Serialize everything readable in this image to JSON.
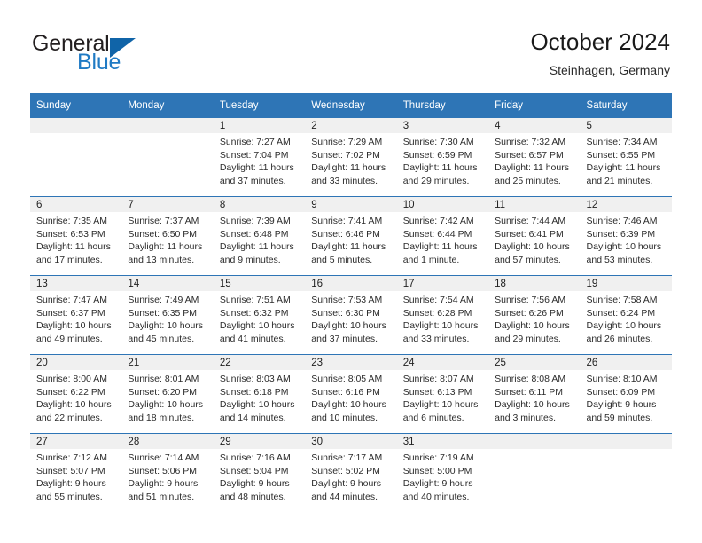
{
  "brand": {
    "name_part1": "General",
    "name_part2": "Blue",
    "triangle_color": "#1064a8",
    "blue_color": "#1f7ac4"
  },
  "header": {
    "title": "October 2024",
    "subtitle": "Steinhagen, Germany"
  },
  "theme": {
    "header_blue": "#2e75b6",
    "date_band_gray": "#f0f0f0",
    "row_divider": "#2e75b6"
  },
  "labels": {
    "sunrise_prefix": "Sunrise:",
    "sunset_prefix": "Sunset:",
    "daylight_prefix": "Daylight:"
  },
  "weekdays": [
    "Sunday",
    "Monday",
    "Tuesday",
    "Wednesday",
    "Thursday",
    "Friday",
    "Saturday"
  ],
  "weeks": [
    [
      {
        "day": "",
        "sunrise": "",
        "sunset": "",
        "daylight_1": "",
        "daylight_2": ""
      },
      {
        "day": "",
        "sunrise": "",
        "sunset": "",
        "daylight_1": "",
        "daylight_2": ""
      },
      {
        "day": "1",
        "sunrise": "Sunrise: 7:27 AM",
        "sunset": "Sunset: 7:04 PM",
        "daylight_1": "Daylight: 11 hours",
        "daylight_2": "and 37 minutes."
      },
      {
        "day": "2",
        "sunrise": "Sunrise: 7:29 AM",
        "sunset": "Sunset: 7:02 PM",
        "daylight_1": "Daylight: 11 hours",
        "daylight_2": "and 33 minutes."
      },
      {
        "day": "3",
        "sunrise": "Sunrise: 7:30 AM",
        "sunset": "Sunset: 6:59 PM",
        "daylight_1": "Daylight: 11 hours",
        "daylight_2": "and 29 minutes."
      },
      {
        "day": "4",
        "sunrise": "Sunrise: 7:32 AM",
        "sunset": "Sunset: 6:57 PM",
        "daylight_1": "Daylight: 11 hours",
        "daylight_2": "and 25 minutes."
      },
      {
        "day": "5",
        "sunrise": "Sunrise: 7:34 AM",
        "sunset": "Sunset: 6:55 PM",
        "daylight_1": "Daylight: 11 hours",
        "daylight_2": "and 21 minutes."
      }
    ],
    [
      {
        "day": "6",
        "sunrise": "Sunrise: 7:35 AM",
        "sunset": "Sunset: 6:53 PM",
        "daylight_1": "Daylight: 11 hours",
        "daylight_2": "and 17 minutes."
      },
      {
        "day": "7",
        "sunrise": "Sunrise: 7:37 AM",
        "sunset": "Sunset: 6:50 PM",
        "daylight_1": "Daylight: 11 hours",
        "daylight_2": "and 13 minutes."
      },
      {
        "day": "8",
        "sunrise": "Sunrise: 7:39 AM",
        "sunset": "Sunset: 6:48 PM",
        "daylight_1": "Daylight: 11 hours",
        "daylight_2": "and 9 minutes."
      },
      {
        "day": "9",
        "sunrise": "Sunrise: 7:41 AM",
        "sunset": "Sunset: 6:46 PM",
        "daylight_1": "Daylight: 11 hours",
        "daylight_2": "and 5 minutes."
      },
      {
        "day": "10",
        "sunrise": "Sunrise: 7:42 AM",
        "sunset": "Sunset: 6:44 PM",
        "daylight_1": "Daylight: 11 hours",
        "daylight_2": "and 1 minute."
      },
      {
        "day": "11",
        "sunrise": "Sunrise: 7:44 AM",
        "sunset": "Sunset: 6:41 PM",
        "daylight_1": "Daylight: 10 hours",
        "daylight_2": "and 57 minutes."
      },
      {
        "day": "12",
        "sunrise": "Sunrise: 7:46 AM",
        "sunset": "Sunset: 6:39 PM",
        "daylight_1": "Daylight: 10 hours",
        "daylight_2": "and 53 minutes."
      }
    ],
    [
      {
        "day": "13",
        "sunrise": "Sunrise: 7:47 AM",
        "sunset": "Sunset: 6:37 PM",
        "daylight_1": "Daylight: 10 hours",
        "daylight_2": "and 49 minutes."
      },
      {
        "day": "14",
        "sunrise": "Sunrise: 7:49 AM",
        "sunset": "Sunset: 6:35 PM",
        "daylight_1": "Daylight: 10 hours",
        "daylight_2": "and 45 minutes."
      },
      {
        "day": "15",
        "sunrise": "Sunrise: 7:51 AM",
        "sunset": "Sunset: 6:32 PM",
        "daylight_1": "Daylight: 10 hours",
        "daylight_2": "and 41 minutes."
      },
      {
        "day": "16",
        "sunrise": "Sunrise: 7:53 AM",
        "sunset": "Sunset: 6:30 PM",
        "daylight_1": "Daylight: 10 hours",
        "daylight_2": "and 37 minutes."
      },
      {
        "day": "17",
        "sunrise": "Sunrise: 7:54 AM",
        "sunset": "Sunset: 6:28 PM",
        "daylight_1": "Daylight: 10 hours",
        "daylight_2": "and 33 minutes."
      },
      {
        "day": "18",
        "sunrise": "Sunrise: 7:56 AM",
        "sunset": "Sunset: 6:26 PM",
        "daylight_1": "Daylight: 10 hours",
        "daylight_2": "and 29 minutes."
      },
      {
        "day": "19",
        "sunrise": "Sunrise: 7:58 AM",
        "sunset": "Sunset: 6:24 PM",
        "daylight_1": "Daylight: 10 hours",
        "daylight_2": "and 26 minutes."
      }
    ],
    [
      {
        "day": "20",
        "sunrise": "Sunrise: 8:00 AM",
        "sunset": "Sunset: 6:22 PM",
        "daylight_1": "Daylight: 10 hours",
        "daylight_2": "and 22 minutes."
      },
      {
        "day": "21",
        "sunrise": "Sunrise: 8:01 AM",
        "sunset": "Sunset: 6:20 PM",
        "daylight_1": "Daylight: 10 hours",
        "daylight_2": "and 18 minutes."
      },
      {
        "day": "22",
        "sunrise": "Sunrise: 8:03 AM",
        "sunset": "Sunset: 6:18 PM",
        "daylight_1": "Daylight: 10 hours",
        "daylight_2": "and 14 minutes."
      },
      {
        "day": "23",
        "sunrise": "Sunrise: 8:05 AM",
        "sunset": "Sunset: 6:16 PM",
        "daylight_1": "Daylight: 10 hours",
        "daylight_2": "and 10 minutes."
      },
      {
        "day": "24",
        "sunrise": "Sunrise: 8:07 AM",
        "sunset": "Sunset: 6:13 PM",
        "daylight_1": "Daylight: 10 hours",
        "daylight_2": "and 6 minutes."
      },
      {
        "day": "25",
        "sunrise": "Sunrise: 8:08 AM",
        "sunset": "Sunset: 6:11 PM",
        "daylight_1": "Daylight: 10 hours",
        "daylight_2": "and 3 minutes."
      },
      {
        "day": "26",
        "sunrise": "Sunrise: 8:10 AM",
        "sunset": "Sunset: 6:09 PM",
        "daylight_1": "Daylight: 9 hours",
        "daylight_2": "and 59 minutes."
      }
    ],
    [
      {
        "day": "27",
        "sunrise": "Sunrise: 7:12 AM",
        "sunset": "Sunset: 5:07 PM",
        "daylight_1": "Daylight: 9 hours",
        "daylight_2": "and 55 minutes."
      },
      {
        "day": "28",
        "sunrise": "Sunrise: 7:14 AM",
        "sunset": "Sunset: 5:06 PM",
        "daylight_1": "Daylight: 9 hours",
        "daylight_2": "and 51 minutes."
      },
      {
        "day": "29",
        "sunrise": "Sunrise: 7:16 AM",
        "sunset": "Sunset: 5:04 PM",
        "daylight_1": "Daylight: 9 hours",
        "daylight_2": "and 48 minutes."
      },
      {
        "day": "30",
        "sunrise": "Sunrise: 7:17 AM",
        "sunset": "Sunset: 5:02 PM",
        "daylight_1": "Daylight: 9 hours",
        "daylight_2": "and 44 minutes."
      },
      {
        "day": "31",
        "sunrise": "Sunrise: 7:19 AM",
        "sunset": "Sunset: 5:00 PM",
        "daylight_1": "Daylight: 9 hours",
        "daylight_2": "and 40 minutes."
      },
      {
        "day": "",
        "sunrise": "",
        "sunset": "",
        "daylight_1": "",
        "daylight_2": ""
      },
      {
        "day": "",
        "sunrise": "",
        "sunset": "",
        "daylight_1": "",
        "daylight_2": ""
      }
    ]
  ]
}
